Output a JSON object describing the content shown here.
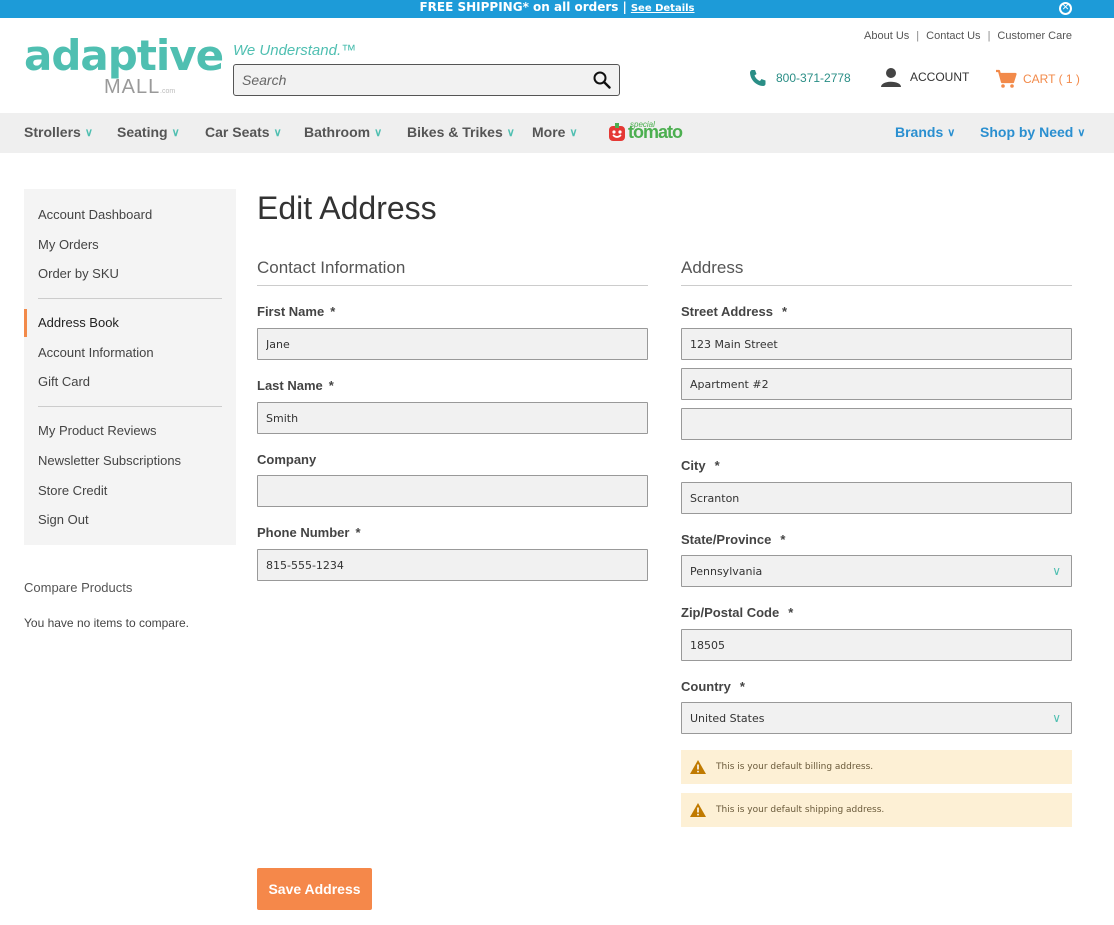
{
  "banner": {
    "text": "FREE SHIPPING* on all orders",
    "sep": "|",
    "details": "See Details"
  },
  "header": {
    "logo_main": "adaptive",
    "logo_sub": "MALL",
    "logo_dot": ".com",
    "tagline": "We Understand.™",
    "search_placeholder": "Search",
    "toplinks": [
      "About Us",
      "Contact Us",
      "Customer Care"
    ],
    "phone": "800-371-2778",
    "account": "ACCOUNT",
    "cart": "CART ( 1 )"
  },
  "nav": {
    "items": [
      "Strollers",
      "Seating",
      "Car Seats",
      "Bathroom",
      "Bikes & Trikes",
      "More"
    ],
    "tomato_small": "special",
    "tomato_big": "tomato",
    "right": [
      "Brands",
      "Shop by Need"
    ]
  },
  "sidebar": {
    "group1": [
      "Account Dashboard",
      "My Orders",
      "Order by SKU"
    ],
    "group2": [
      "Address Book",
      "Account Information",
      "Gift Card"
    ],
    "group3": [
      "My Product Reviews",
      "Newsletter Subscriptions",
      "Store Credit",
      "Sign Out"
    ]
  },
  "compare": {
    "title": "Compare Products",
    "text": "You have no items to compare."
  },
  "page_title": "Edit Address",
  "contact": {
    "title": "Contact Information",
    "first_name_label": "First Name",
    "first_name": "Jane",
    "last_name_label": "Last Name",
    "last_name": "Smith",
    "company_label": "Company",
    "company": "",
    "phone_label": "Phone Number",
    "phone": "815-555-1234"
  },
  "address": {
    "title": "Address",
    "street_label": "Street Address",
    "street1": "123 Main Street",
    "street2": "Apartment #2",
    "street3": "",
    "city_label": "City",
    "city": "Scranton",
    "state_label": "State/Province",
    "state": "Pennsylvania",
    "zip_label": "Zip/Postal Code",
    "zip": "18505",
    "country_label": "Country",
    "country": "United States",
    "billing_notice": "This is your default billing address.",
    "shipping_notice": "This is your default shipping address."
  },
  "required_mark": "*",
  "save_label": "Save Address",
  "colors": {
    "accent": "#4fbfb1",
    "orange": "#f5884a",
    "blue": "#1d9bd8"
  }
}
